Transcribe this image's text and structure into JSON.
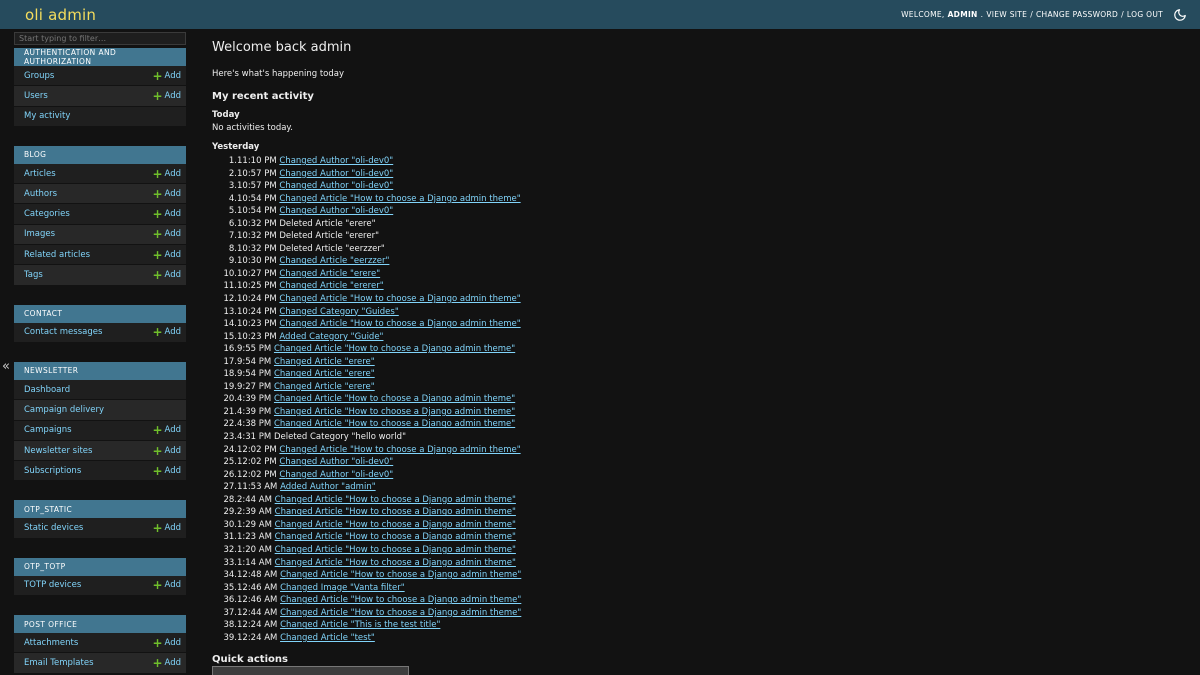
{
  "header": {
    "branding": "oli admin",
    "welcome": "WELCOME,",
    "username": "ADMIN",
    "view_site": "VIEW SITE",
    "change_password": "CHANGE PASSWORD",
    "log_out": "LOG OUT",
    "theme_icon": "moon-icon"
  },
  "sidebar": {
    "filter_placeholder": "Start typing to filter…",
    "collapse_glyph": "«",
    "add_label": "Add",
    "modules": [
      {
        "caption": "AUTHENTICATION AND AUTHORIZATION",
        "models": [
          {
            "name": "Groups",
            "add": true
          },
          {
            "name": "Users",
            "add": true
          },
          {
            "name": "My activity",
            "add": false
          }
        ]
      },
      {
        "caption": "BLOG",
        "models": [
          {
            "name": "Articles",
            "add": true
          },
          {
            "name": "Authors",
            "add": true
          },
          {
            "name": "Categories",
            "add": true
          },
          {
            "name": "Images",
            "add": true
          },
          {
            "name": "Related articles",
            "add": true
          },
          {
            "name": "Tags",
            "add": true
          }
        ]
      },
      {
        "caption": "CONTACT",
        "models": [
          {
            "name": "Contact messages",
            "add": true
          }
        ]
      },
      {
        "caption": "NEWSLETTER",
        "models": [
          {
            "name": "Dashboard",
            "add": false
          },
          {
            "name": "Campaign delivery",
            "add": false
          },
          {
            "name": "Campaigns",
            "add": true
          },
          {
            "name": "Newsletter sites",
            "add": true
          },
          {
            "name": "Subscriptions",
            "add": true
          }
        ]
      },
      {
        "caption": "OTP_STATIC",
        "models": [
          {
            "name": "Static devices",
            "add": true
          }
        ]
      },
      {
        "caption": "OTP_TOTP",
        "models": [
          {
            "name": "TOTP devices",
            "add": true
          }
        ]
      },
      {
        "caption": "POST OFFICE",
        "models": [
          {
            "name": "Attachments",
            "add": true
          },
          {
            "name": "Email Templates",
            "add": true
          }
        ]
      }
    ]
  },
  "content": {
    "title": "Welcome back admin",
    "subtitle": "Here's what's happening today",
    "recent_heading": "My recent activity",
    "today_heading": "Today",
    "today_empty": "No activities today.",
    "yesterday_heading": "Yesterday",
    "quick_actions_heading": "Quick actions",
    "activities": [
      {
        "time": "11:10 PM",
        "text": "Changed Author \"oli-dev0\"",
        "link": true
      },
      {
        "time": "10:57 PM",
        "text": "Changed Author \"oli-dev0\"",
        "link": true
      },
      {
        "time": "10:57 PM",
        "text": "Changed Author \"oli-dev0\"",
        "link": true
      },
      {
        "time": "10:54 PM",
        "text": "Changed Article \"How to choose a Django admin theme\"",
        "link": true
      },
      {
        "time": "10:54 PM",
        "text": "Changed Author \"oli-dev0\"",
        "link": true
      },
      {
        "time": "10:32 PM",
        "text": "Deleted Article \"erere\"",
        "link": false
      },
      {
        "time": "10:32 PM",
        "text": "Deleted Article \"ererer\"",
        "link": false
      },
      {
        "time": "10:32 PM",
        "text": "Deleted Article \"eerzzer\"",
        "link": false
      },
      {
        "time": "10:30 PM",
        "text": "Changed Article \"eerzzer\"",
        "link": true
      },
      {
        "time": "10:27 PM",
        "text": "Changed Article \"erere\"",
        "link": true
      },
      {
        "time": "10:25 PM",
        "text": "Changed Article \"ererer\"",
        "link": true
      },
      {
        "time": "10:24 PM",
        "text": "Changed Article \"How to choose a Django admin theme\"",
        "link": true
      },
      {
        "time": "10:24 PM",
        "text": "Changed Category \"Guides\"",
        "link": true
      },
      {
        "time": "10:23 PM",
        "text": "Changed Article \"How to choose a Django admin theme\"",
        "link": true
      },
      {
        "time": "10:23 PM",
        "text": "Added Category \"Guide\"",
        "link": true
      },
      {
        "time": "9:55 PM",
        "text": "Changed Article \"How to choose a Django admin theme\"",
        "link": true
      },
      {
        "time": "9:54 PM",
        "text": "Changed Article \"erere\"",
        "link": true
      },
      {
        "time": "9:54 PM",
        "text": "Changed Article \"erere\"",
        "link": true
      },
      {
        "time": "9:27 PM",
        "text": "Changed Article \"erere\"",
        "link": true
      },
      {
        "time": "4:39 PM",
        "text": "Changed Article \"How to choose a Django admin theme\"",
        "link": true
      },
      {
        "time": "4:39 PM",
        "text": "Changed Article \"How to choose a Django admin theme\"",
        "link": true
      },
      {
        "time": "4:38 PM",
        "text": "Changed Article \"How to choose a Django admin theme\"",
        "link": true
      },
      {
        "time": "4:31 PM",
        "text": "Deleted Category \"hello world\"",
        "link": false
      },
      {
        "time": "12:02 PM",
        "text": "Changed Article \"How to choose a Django admin theme\"",
        "link": true
      },
      {
        "time": "12:02 PM",
        "text": "Changed Author \"oli-dev0\"",
        "link": true
      },
      {
        "time": "12:02 PM",
        "text": "Changed Author \"oli-dev0\"",
        "link": true
      },
      {
        "time": "11:53 AM",
        "text": "Added Author \"admin\"",
        "link": true
      },
      {
        "time": "2:44 AM",
        "text": "Changed Article \"How to choose a Django admin theme\"",
        "link": true
      },
      {
        "time": "2:39 AM",
        "text": "Changed Article \"How to choose a Django admin theme\"",
        "link": true
      },
      {
        "time": "1:29 AM",
        "text": "Changed Article \"How to choose a Django admin theme\"",
        "link": true
      },
      {
        "time": "1:23 AM",
        "text": "Changed Article \"How to choose a Django admin theme\"",
        "link": true
      },
      {
        "time": "1:20 AM",
        "text": "Changed Article \"How to choose a Django admin theme\"",
        "link": true
      },
      {
        "time": "1:14 AM",
        "text": "Changed Article \"How to choose a Django admin theme\"",
        "link": true
      },
      {
        "time": "12:48 AM",
        "text": "Changed Article \"How to choose a Django admin theme\"",
        "link": true
      },
      {
        "time": "12:46 AM",
        "text": "Changed Image \"Vanta filter\"",
        "link": true
      },
      {
        "time": "12:46 AM",
        "text": "Changed Article \"How to choose a Django admin theme\"",
        "link": true
      },
      {
        "time": "12:44 AM",
        "text": "Changed Article \"How to choose a Django admin theme\"",
        "link": true
      },
      {
        "time": "12:24 AM",
        "text": "Changed Article \"This is the test title\"",
        "link": true
      },
      {
        "time": "12:24 AM",
        "text": "Changed Article \"test\"",
        "link": true
      }
    ]
  },
  "colors": {
    "header_bg": "#264b5d",
    "branding": "#f5dd5d",
    "module_caption_bg": "#417690",
    "link": "#81d4fa",
    "add_plus": "#70bf2b",
    "page_bg": "#121212"
  }
}
